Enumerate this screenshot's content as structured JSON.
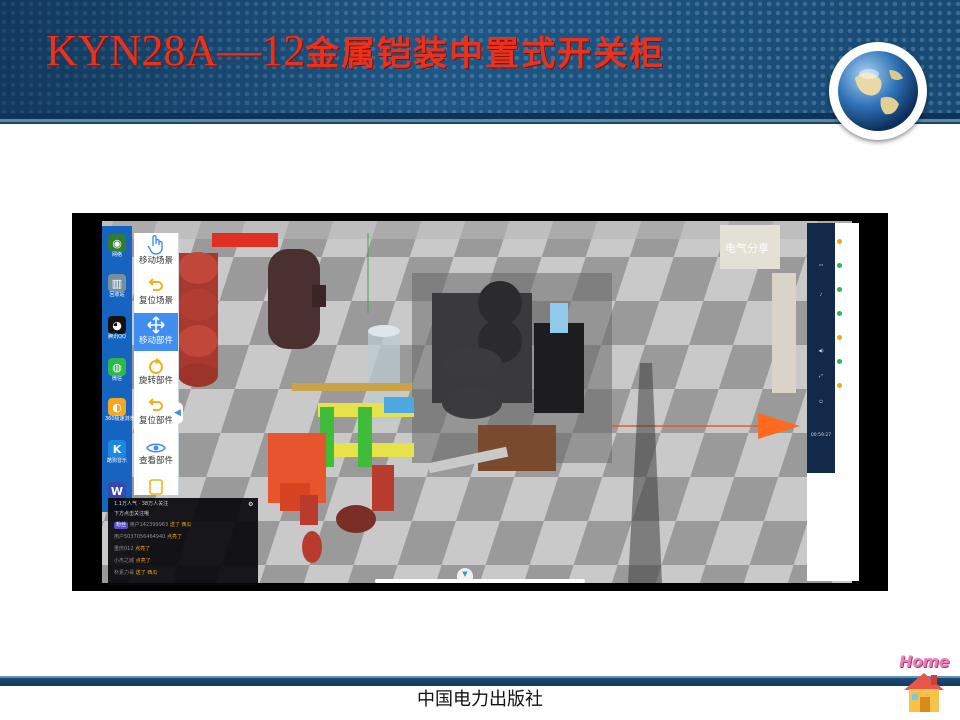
{
  "slide": {
    "title_latin": "KYN28A—12",
    "title_cjk": "金属铠装中置式开关柜",
    "footer": "中国电力出版社",
    "home_label": "Home"
  },
  "app": {
    "watermark": "电气分享",
    "toolbar": [
      {
        "label": "移动场景",
        "icon": "hand-pointer-icon",
        "active": false
      },
      {
        "label": "复位场景",
        "icon": "undo-arrow-icon",
        "active": false
      },
      {
        "label": "移动部件",
        "icon": "move-arrows-icon",
        "active": true
      },
      {
        "label": "旋转部件",
        "icon": "rotate-icon",
        "active": false
      },
      {
        "label": "复位部件",
        "icon": "reset-icon",
        "active": false
      },
      {
        "label": "查看部件",
        "icon": "eye-icon",
        "active": false
      }
    ],
    "desktop_icons": [
      {
        "label": "网络",
        "color": "#2e7d32",
        "glyph": "◉"
      },
      {
        "label": "回收站",
        "color": "#78909c",
        "glyph": "▥"
      },
      {
        "label": "腾讯QQ",
        "color": "#111111",
        "glyph": "◕"
      },
      {
        "label": "微信",
        "color": "#2db84b",
        "glyph": "◍"
      },
      {
        "label": "360极速浏览器",
        "color": "#f5a623",
        "glyph": "◐"
      },
      {
        "label": "酷狗音乐",
        "color": "#1e88e5",
        "glyph": "K"
      },
      {
        "label": "",
        "color": "#3949ab",
        "glyph": "W"
      }
    ],
    "live_chat": {
      "stats_popularity": "1.1万人气",
      "stats_followers": "38万人关注",
      "notice": "下方点击关注哦",
      "badge": "粉丝",
      "rows": [
        {
          "user": "用户142399963",
          "action": "送了 西瓜"
        },
        {
          "user": "用户5037056464940",
          "action": "点亮了"
        },
        {
          "user": "重庆012",
          "action": "点亮了"
        },
        {
          "user": "小杰之城",
          "action": "点亮了"
        },
        {
          "user": "朴素力哥",
          "action": "送了 西瓜"
        }
      ]
    },
    "right_panel_time": "00:59:27"
  },
  "colors": {
    "title_red": "#e8321e",
    "banner_blue": "#1f5684",
    "accent_blue": "#3f8ef0"
  }
}
